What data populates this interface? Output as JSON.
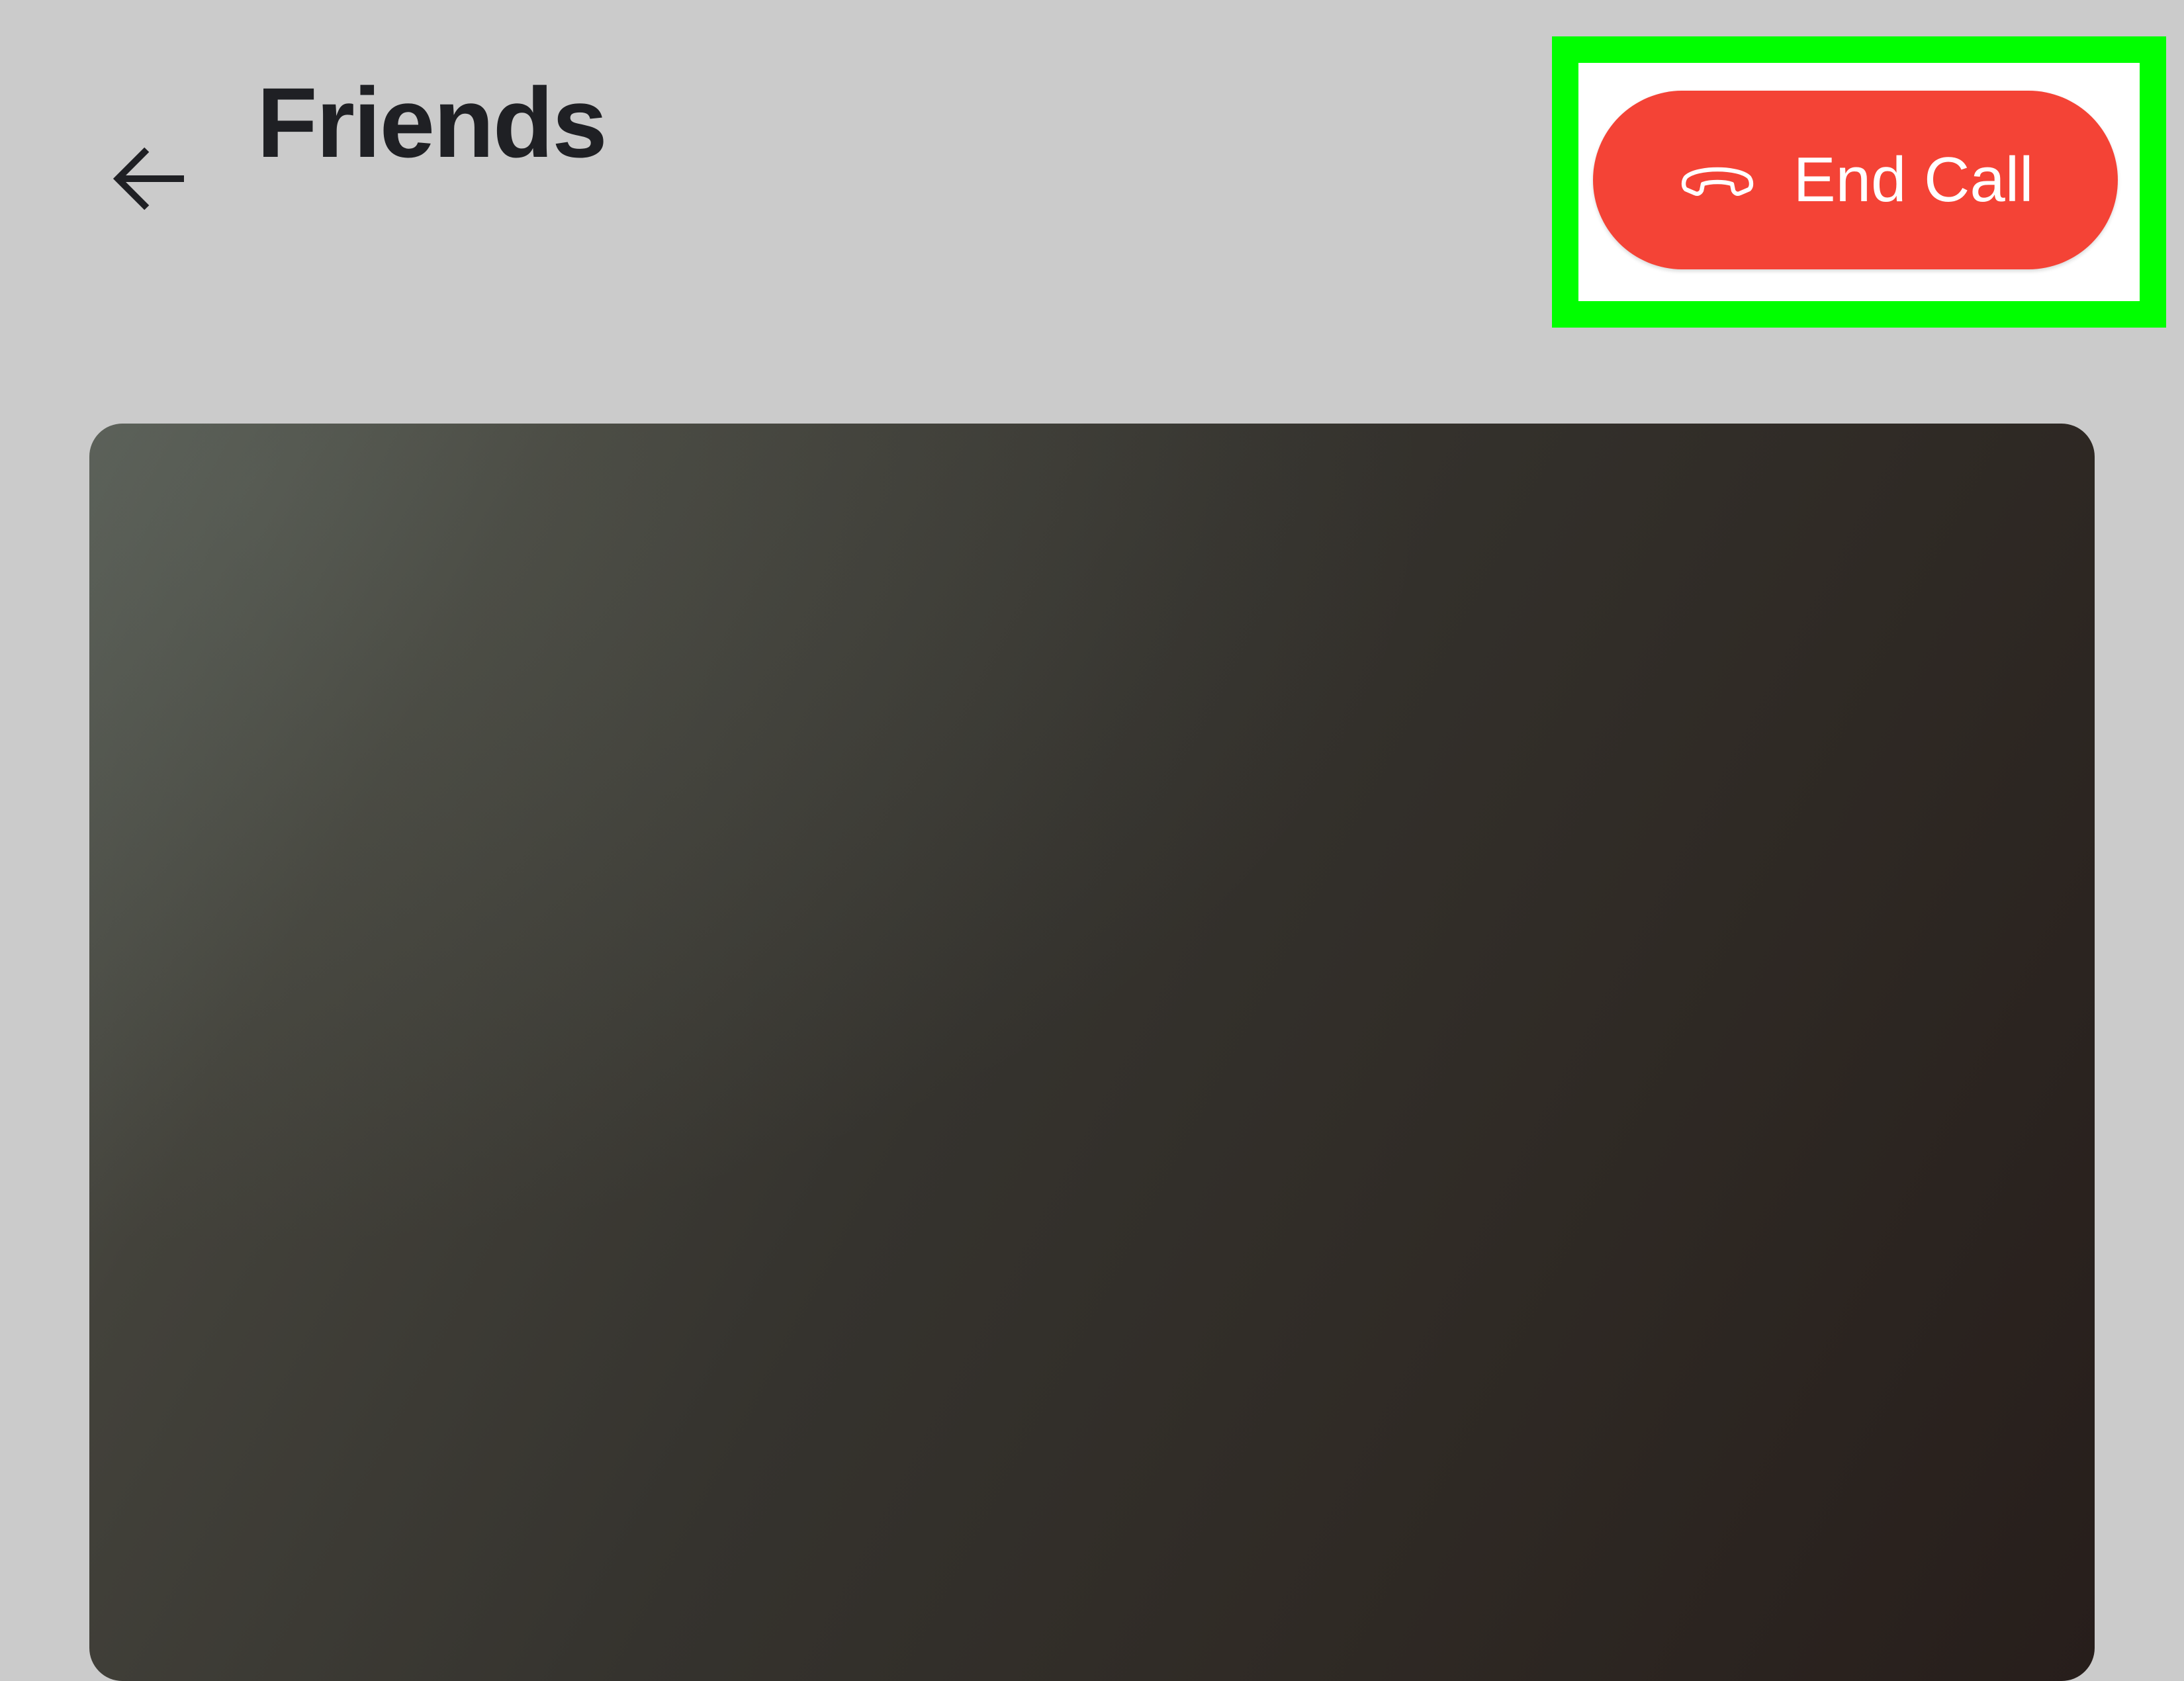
{
  "header": {
    "title": "Friends",
    "back_icon": "arrow-left-icon"
  },
  "call_controls": {
    "end_call_label": "End Call",
    "end_call_icon": "phone-hangup-icon",
    "end_call_color": "#f44336",
    "highlight_color": "#00ff00"
  },
  "video": {
    "background_colors": [
      "#565a53",
      "#35332e",
      "#271e1b"
    ]
  },
  "colors": {
    "page_background": "#cbcbcb",
    "title_color": "#1f2024"
  }
}
